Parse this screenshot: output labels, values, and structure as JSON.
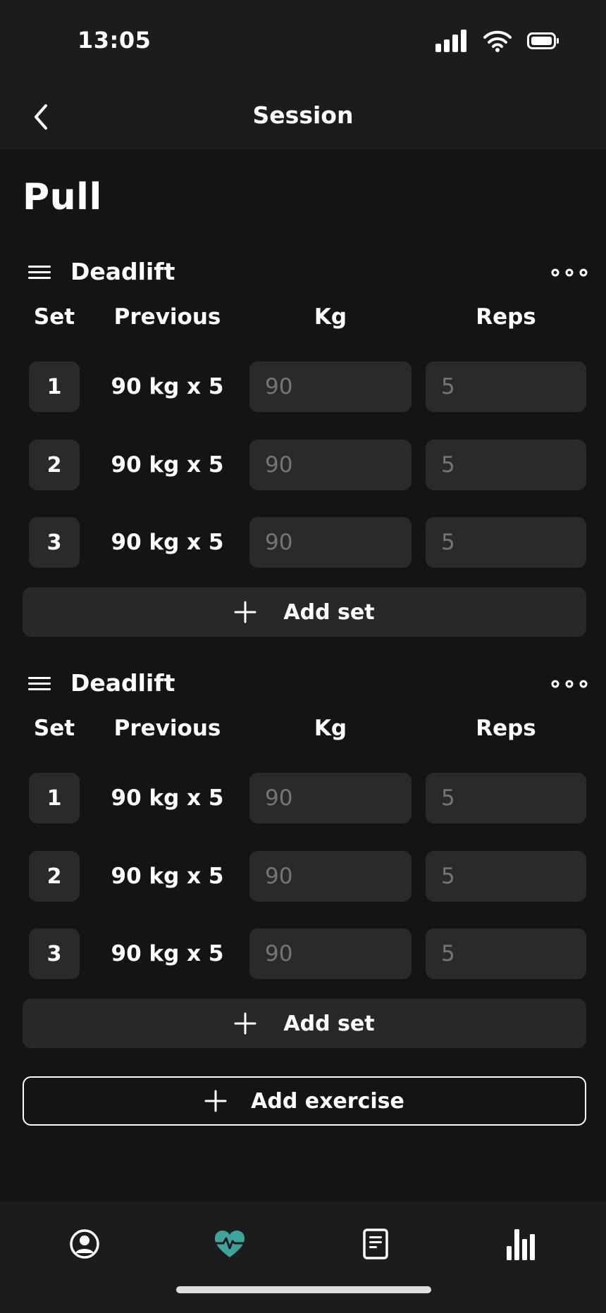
{
  "status_bar": {
    "time": "13:05"
  },
  "nav": {
    "title": "Session"
  },
  "session_name": "Pull",
  "columns": {
    "set": "Set",
    "previous": "Previous",
    "kg": "Kg",
    "reps": "Reps"
  },
  "exercises": [
    {
      "name": "Deadlift",
      "sets": [
        {
          "number": "1",
          "previous": "90 kg x 5",
          "kg_placeholder": "90",
          "reps_placeholder": "5"
        },
        {
          "number": "2",
          "previous": "90 kg x 5",
          "kg_placeholder": "90",
          "reps_placeholder": "5"
        },
        {
          "number": "3",
          "previous": "90 kg x 5",
          "kg_placeholder": "90",
          "reps_placeholder": "5"
        }
      ],
      "add_set_label": "Add set"
    },
    {
      "name": "Deadlift",
      "sets": [
        {
          "number": "1",
          "previous": "90 kg x 5",
          "kg_placeholder": "90",
          "reps_placeholder": "5"
        },
        {
          "number": "2",
          "previous": "90 kg x 5",
          "kg_placeholder": "90",
          "reps_placeholder": "5"
        },
        {
          "number": "3",
          "previous": "90 kg x 5",
          "kg_placeholder": "90",
          "reps_placeholder": "5"
        }
      ],
      "add_set_label": "Add set"
    }
  ],
  "add_exercise_label": "Add exercise",
  "tab_bar": {
    "tabs": [
      {
        "icon": "profile-icon",
        "active": false
      },
      {
        "icon": "heart-pulse-icon",
        "active": true
      },
      {
        "icon": "document-icon",
        "active": false
      },
      {
        "icon": "bar-chart-icon",
        "active": false
      }
    ]
  },
  "colors": {
    "background": "#141416",
    "surface": "#1c1c1e",
    "field": "#2a2a2d",
    "accent": "#3fa39b",
    "text": "#ffffff",
    "placeholder": "#a5a5a8"
  }
}
